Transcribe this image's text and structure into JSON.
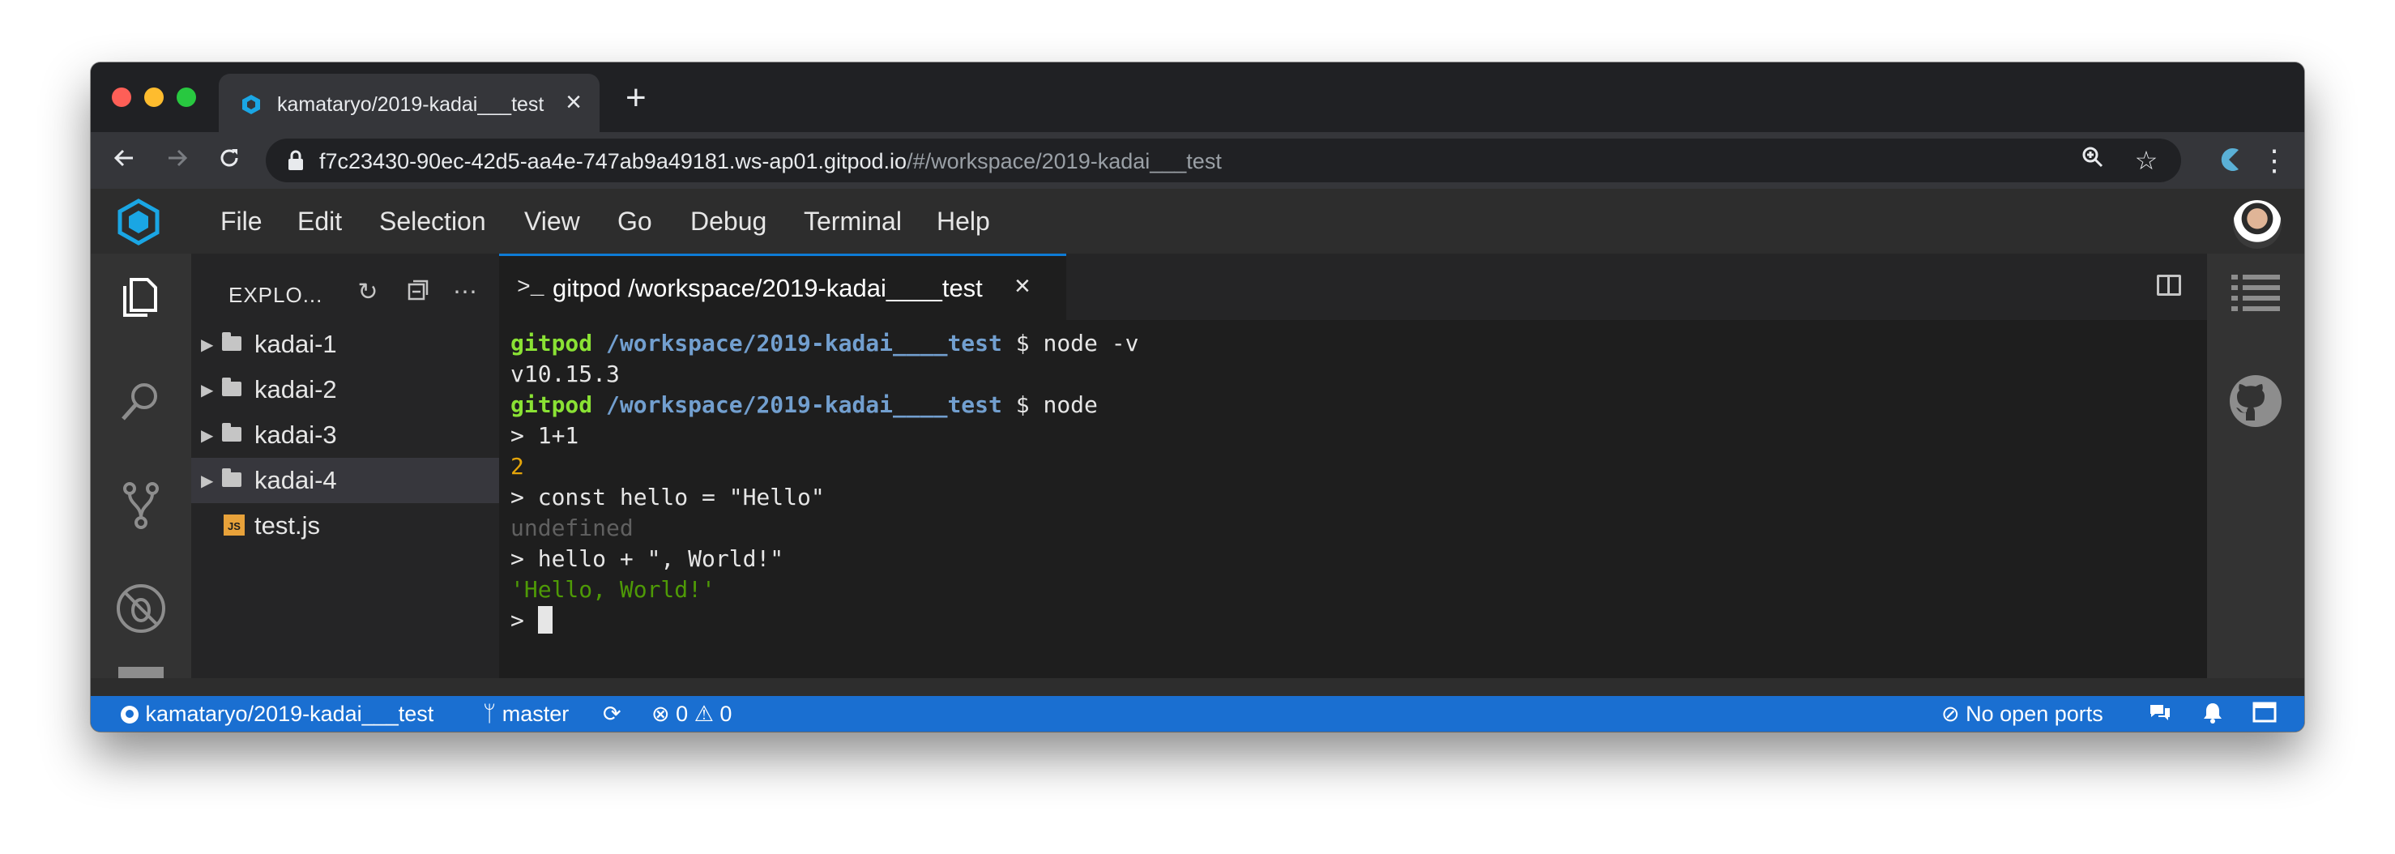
{
  "browser": {
    "tab_title": "kamataryo/2019-kadai___test",
    "url_host": "f7c23430-90ec-42d5-aa4e-747ab9a49181.ws-ap01.gitpod.io",
    "url_path": "/#/workspace/2019-kadai___test",
    "icons": [
      "back-icon",
      "forward-icon",
      "reload-icon",
      "lock-icon",
      "zoom-icon",
      "star-icon",
      "extension-icon",
      "menu-icon"
    ]
  },
  "menu": {
    "items": [
      "File",
      "Edit",
      "Selection",
      "View",
      "Go",
      "Debug",
      "Terminal",
      "Help"
    ]
  },
  "explorer": {
    "title": "EXPLO...",
    "items": [
      {
        "label": "kadai-1",
        "type": "folder"
      },
      {
        "label": "kadai-2",
        "type": "folder"
      },
      {
        "label": "kadai-3",
        "type": "folder"
      },
      {
        "label": "kadai-4",
        "type": "folder",
        "selected": true
      },
      {
        "label": "test.js",
        "type": "js-file"
      }
    ]
  },
  "terminal": {
    "tab_label": "gitpod /workspace/2019-kadai____test",
    "tab_icon": ">_",
    "lines": {
      "l1_user": "gitpod",
      "l1_path": "/workspace/2019-kadai____test",
      "l1_cmd": " $ node -v",
      "l2": "v10.15.3",
      "l3_user": "gitpod",
      "l3_path": "/workspace/2019-kadai____test",
      "l3_cmd": " $ node",
      "l4": "> 1+1",
      "l5": "2",
      "l6": "> const hello = \"Hello\"",
      "l7": "undefined",
      "l8": "> hello + \", World!\"",
      "l9": "'Hello, World!'",
      "l10": "> "
    }
  },
  "statusbar": {
    "repo": "kamataryo/2019-kadai___test",
    "branch": "master",
    "errors": "0",
    "warnings": "0",
    "ports": "No open ports"
  },
  "colors": {
    "accent": "#1a6fd1",
    "prompt_user": "#8ae234",
    "prompt_path": "#729fcf"
  }
}
